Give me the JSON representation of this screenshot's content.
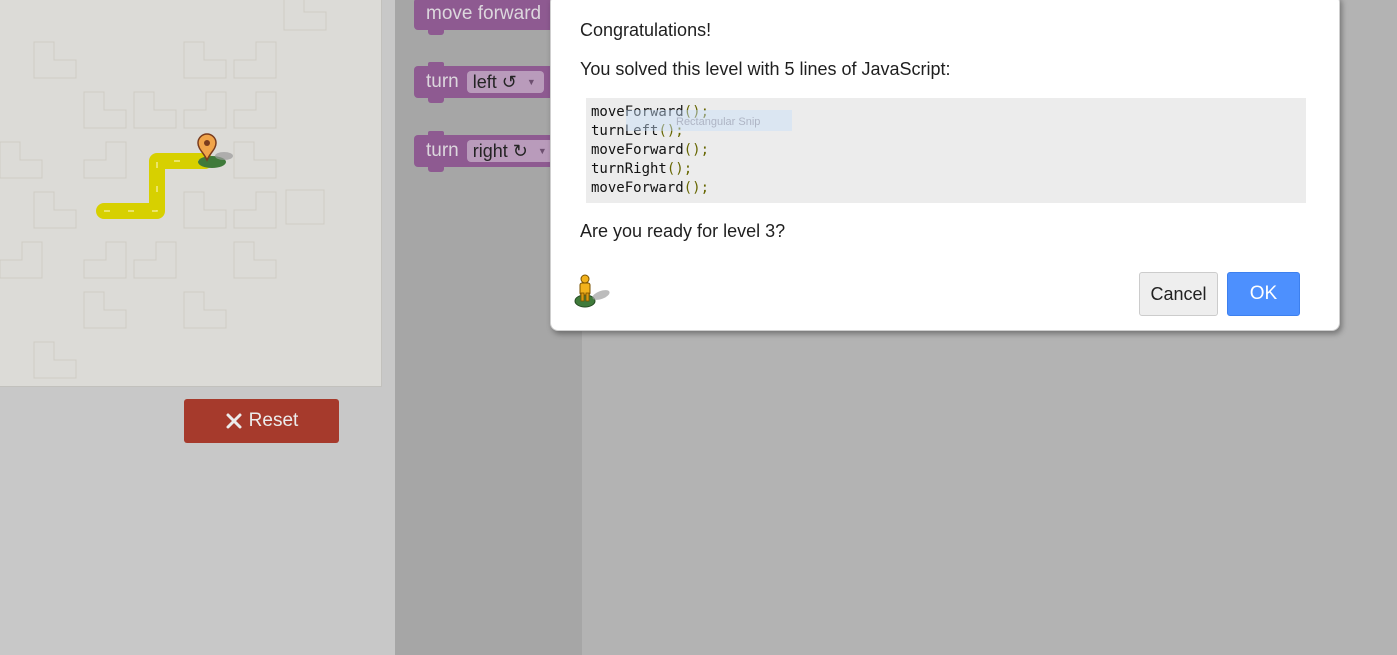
{
  "toolbox": {
    "blocks": [
      {
        "label": "move forward"
      },
      {
        "label": "turn",
        "option": "left ↺"
      },
      {
        "label": "turn",
        "option": "right ↻"
      }
    ]
  },
  "maze": {
    "reset_label": "Reset"
  },
  "dialog": {
    "title": "Congratulations!",
    "solved_text": "You solved this level with 5 lines of JavaScript:",
    "code_lines": [
      {
        "name": "moveForward",
        "suffix": "();"
      },
      {
        "name": "turnLeft",
        "suffix": "();"
      },
      {
        "name": "moveForward",
        "suffix": "();"
      },
      {
        "name": "turnRight",
        "suffix": "();"
      },
      {
        "name": "moveForward",
        "suffix": "();"
      }
    ],
    "snip_text": "Rectangular Snip",
    "question": "Are you ready for level 3?",
    "cancel_label": "Cancel",
    "ok_label": "OK"
  },
  "colors": {
    "block_purple": "#8e5a91",
    "reset_red": "#a63a2c",
    "ok_blue": "#4d90fe",
    "path_yellow": "#d7d000"
  },
  "icons": [
    "close-icon",
    "pegman-icon",
    "map-marker-icon",
    "rotate-left-icon",
    "rotate-right-icon",
    "dropdown-arrow-icon"
  ]
}
